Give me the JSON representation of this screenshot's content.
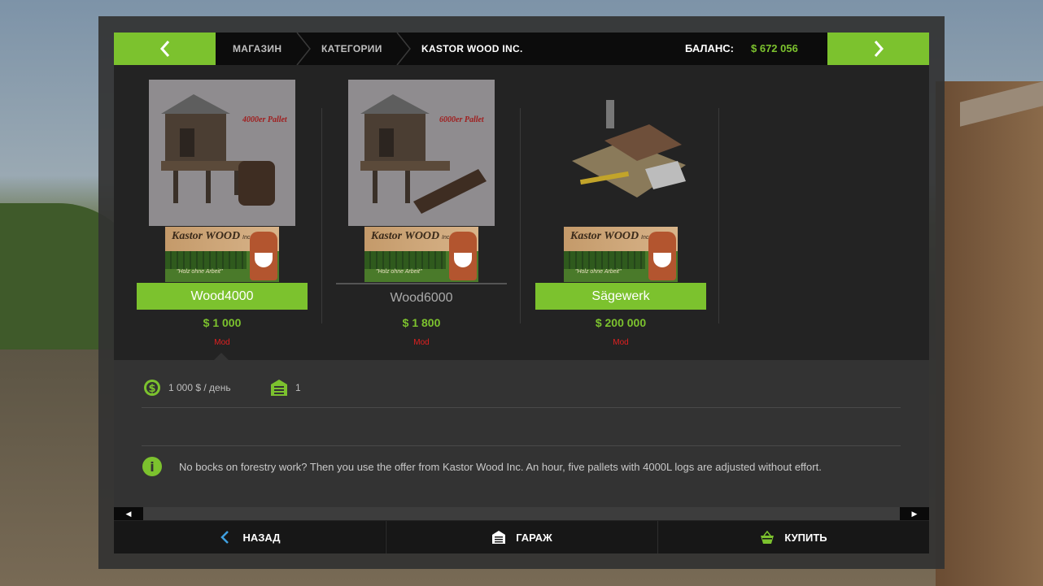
{
  "breadcrumb": {
    "prev_icon": "chevron-left-icon",
    "next_icon": "chevron-right-icon",
    "items": [
      "МАГАЗИН",
      "КАТЕГОРИИ",
      "KASTOR WOOD INC."
    ]
  },
  "balance": {
    "label": "БАЛАНС:",
    "value": "$ 672 056"
  },
  "items": [
    {
      "image_text": "4000er Pallet",
      "logo_text": "Kastor WOOD",
      "logo_inc": "Inc",
      "logo_slogan": "\"Holz ohne Arbeit\"",
      "name": "Wood4000",
      "price": "$ 1 000",
      "tag": "Mod",
      "selected": true
    },
    {
      "image_text": "6000er Pallet",
      "logo_text": "Kastor WOOD",
      "logo_inc": "Inc",
      "logo_slogan": "\"Holz ohne Arbeit\"",
      "name": "Wood6000",
      "price": "$ 1 800",
      "tag": "Mod",
      "selected": false
    },
    {
      "image_text": "",
      "logo_text": "Kastor WOOD",
      "logo_inc": "Inc",
      "logo_slogan": "\"Holz ohne Arbeit\"",
      "name": "Sägewerk",
      "price": "$ 200 000",
      "tag": "Mod",
      "selected": true
    }
  ],
  "details": {
    "upkeep": {
      "icon": "dollar-gear-icon",
      "text": "1 000 $ / день"
    },
    "count": {
      "icon": "garage-icon",
      "text": "1"
    },
    "info_icon": "info-icon",
    "description": "No bocks on forestry work? Then you use the offer from Kastor Wood Inc. An hour, five pallets with 4000L logs are adjusted without effort."
  },
  "buttons": {
    "back": {
      "label": "НАЗАД",
      "icon": "chevron-left-icon"
    },
    "garage": {
      "label": "ГАРАЖ",
      "icon": "garage-icon"
    },
    "buy": {
      "label": "КУПИТЬ",
      "icon": "basket-icon"
    }
  },
  "colors": {
    "accent": "#7cc22e",
    "tag": "#e02020",
    "panel": "#232323"
  }
}
